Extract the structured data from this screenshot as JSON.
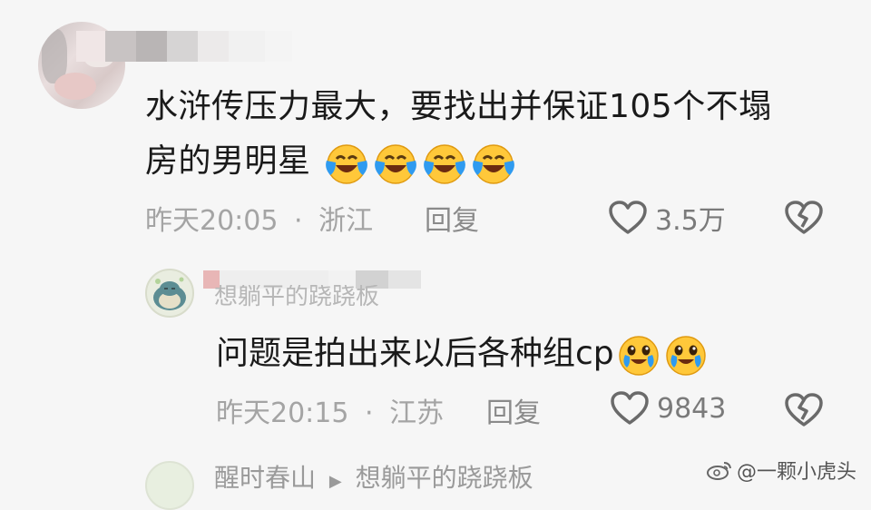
{
  "comment": {
    "avatar_icon": "user-avatar-icon",
    "text_line1": "水浒传压力最大，要找出并保证105个不塌",
    "text_line2": "房的男明星",
    "emoji_icon": "laughing-crying-emoji-icon",
    "time": "昨天20:05",
    "separator": "·",
    "location": "浙江",
    "reply_label": "回复",
    "like_icon": "heart-outline-icon",
    "like_count": "3.5万",
    "dislike_icon": "broken-heart-icon"
  },
  "reply": {
    "avatar_icon": "snorlax-avatar-icon",
    "username": "想躺平的跷跷板",
    "text": "问题是拍出来以后各种组cp",
    "emoji_icon": "teary-laugh-emoji-icon",
    "time": "昨天20:15",
    "separator": "·",
    "location": "江苏",
    "reply_label": "回复",
    "like_icon": "heart-outline-icon",
    "like_count": "9843",
    "dislike_icon": "broken-heart-icon"
  },
  "next_reply": {
    "avatar_icon": "user-avatar-icon",
    "username": "醒时春山",
    "arrow_icon": "play-arrow-icon",
    "reply_to": "想躺平的跷跷板"
  },
  "watermark": {
    "icon": "weibo-logo-icon",
    "text": "@一颗小虎头"
  },
  "colors": {
    "background": "#f6f6f6",
    "text": "#1a1a1a",
    "meta": "#a4a4a4",
    "emoji_face": "#ffc83a",
    "emoji_tear": "#2f9bf0"
  }
}
